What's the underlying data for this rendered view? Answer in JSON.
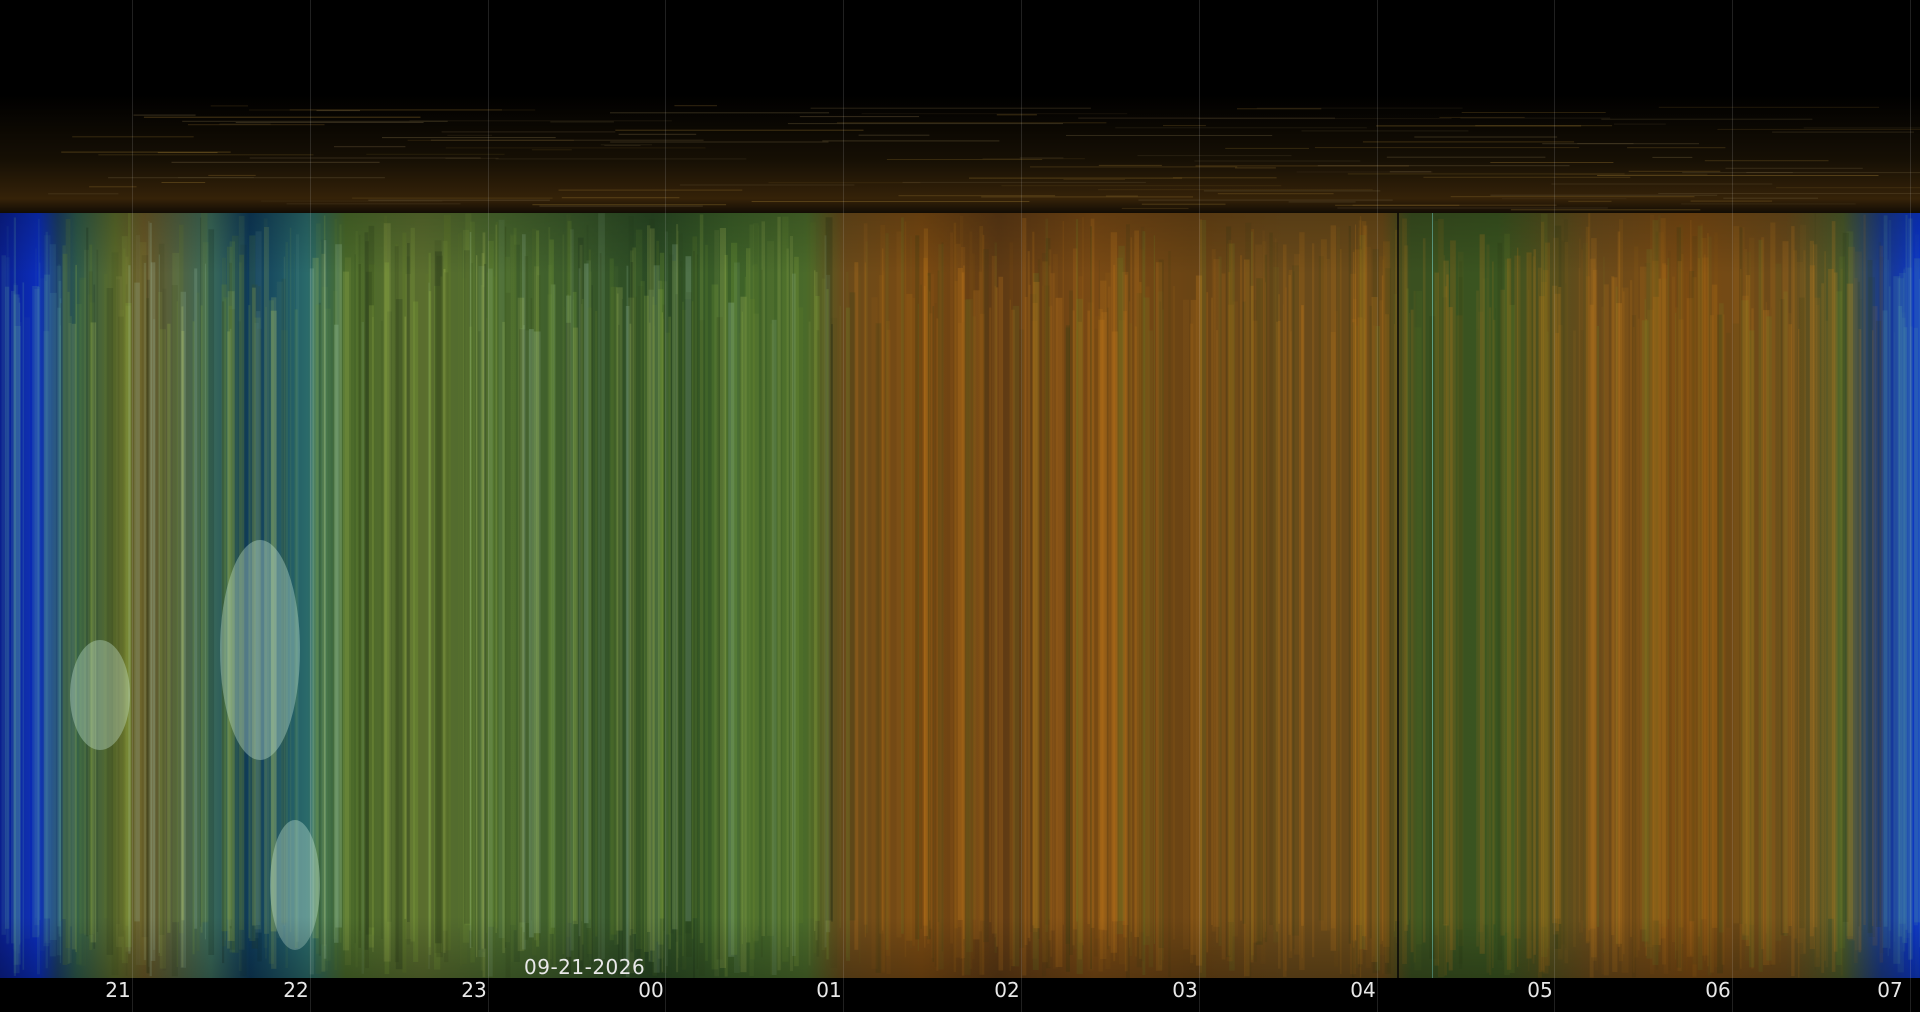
{
  "date_label": "09-21-2026",
  "time_axis": {
    "tick_labels": [
      "21",
      "22",
      "23",
      "00",
      "01",
      "02",
      "03",
      "04",
      "05",
      "06",
      "07"
    ]
  }
}
